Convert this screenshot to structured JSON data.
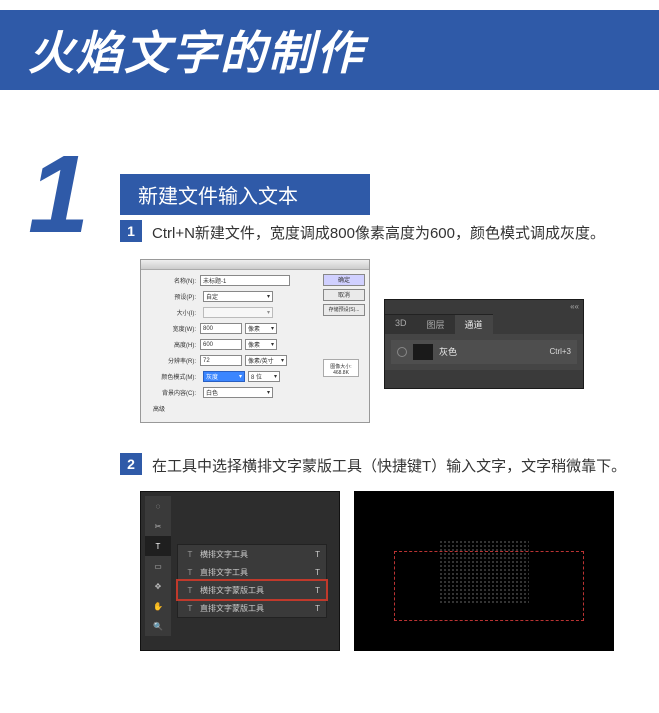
{
  "title": "火焰文字的制作",
  "step_number": "1",
  "step_heading": "新建文件输入文本",
  "sub1": {
    "num": "1",
    "text": "Ctrl+N新建文件，宽度调成800像素高度为600，颜色模式调成灰度。"
  },
  "sub2": {
    "num": "2",
    "text": "在工具中选择横排文字蒙版工具（快捷键T）输入文字，文字稍微靠下。"
  },
  "new_dialog": {
    "name_label": "名称(N):",
    "name_value": "未标题-1",
    "preset_label": "预设(P):",
    "preset_value": "自定",
    "size_label": "大小(I):",
    "width_label": "宽度(W):",
    "width_value": "800",
    "width_unit": "像素",
    "height_label": "高度(H):",
    "height_value": "600",
    "height_unit": "像素",
    "res_label": "分辨率(R):",
    "res_value": "72",
    "res_unit": "像素/英寸",
    "mode_label": "颜色模式(M):",
    "mode_value": "灰度",
    "mode_bits": "8 位",
    "bg_label": "背景内容(C):",
    "bg_value": "白色",
    "advanced": "高级",
    "btn_ok": "确定",
    "btn_cancel": "取消",
    "btn_save": "存储预设(S)...",
    "preview_label": "图像大小:",
    "preview_size": "468.8K"
  },
  "layers_panel": {
    "close": "««",
    "tabs": [
      "3D",
      "图层",
      "通道"
    ],
    "active_tab_index": 2,
    "channel_name": "灰色",
    "channel_shortcut": "Ctrl+3"
  },
  "tool_flyout": {
    "items": [
      {
        "icon": "T",
        "label": "横排文字工具",
        "shortcut": "T"
      },
      {
        "icon": "T",
        "label": "直排文字工具",
        "shortcut": "T"
      },
      {
        "icon": "T",
        "label": "横排文字蒙版工具",
        "shortcut": "T"
      },
      {
        "icon": "T",
        "label": "直排文字蒙版工具",
        "shortcut": "T"
      }
    ],
    "selected_index": 2
  },
  "canvas_text": "传智"
}
